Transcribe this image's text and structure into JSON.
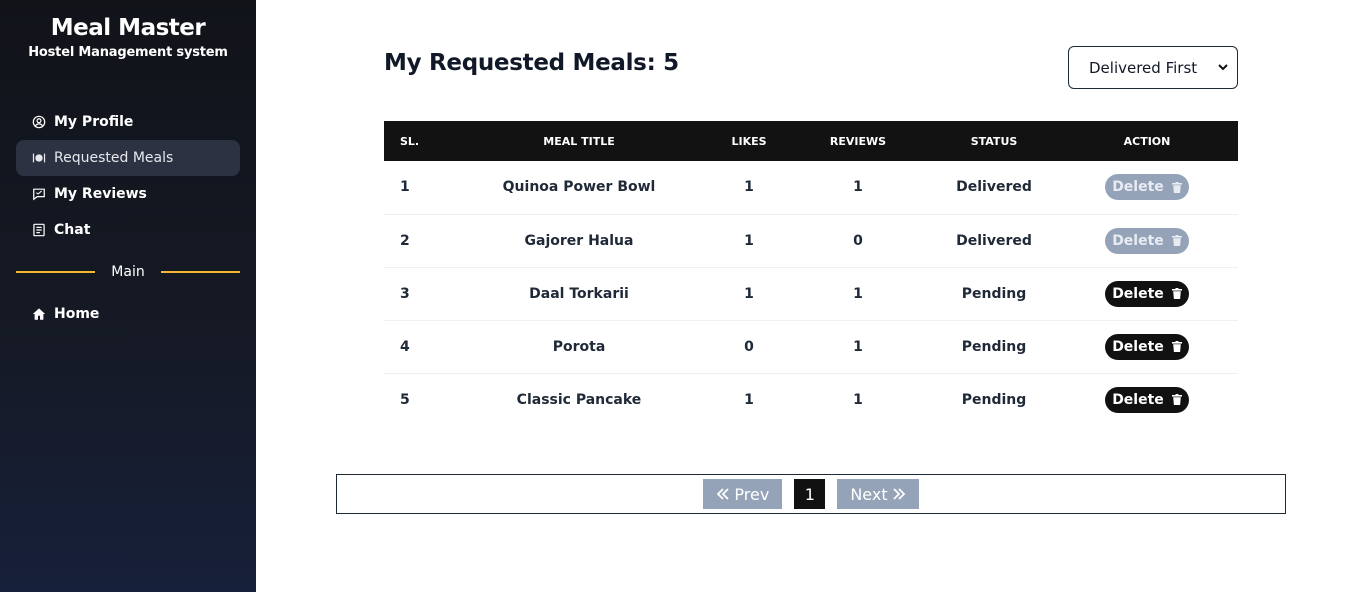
{
  "sidebar": {
    "brand_title": "Meal Master",
    "brand_subtitle": "Hostel Management system",
    "items": [
      {
        "label": "My Profile",
        "icon": "user-circle-icon"
      },
      {
        "label": "Requested Meals",
        "icon": "utensils-icon",
        "active": true
      },
      {
        "label": "My Reviews",
        "icon": "review-icon"
      },
      {
        "label": "Chat",
        "icon": "chat-icon"
      }
    ],
    "divider_label": "Main",
    "main_items": [
      {
        "label": "Home",
        "icon": "home-icon"
      }
    ],
    "accent_color": "#f5b731"
  },
  "main": {
    "heading": "My Requested Meals: 5",
    "sort": {
      "selected": "Delivered First"
    },
    "table": {
      "headers": [
        "SL.",
        "MEAL TITLE",
        "LIKES",
        "REVIEWS",
        "STATUS",
        "ACTION"
      ],
      "rows": [
        {
          "sl": "1",
          "title": "Quinoa Power Bowl",
          "likes": "1",
          "reviews": "1",
          "status": "Delivered",
          "action": "Delete"
        },
        {
          "sl": "2",
          "title": "Gajorer Halua",
          "likes": "1",
          "reviews": "0",
          "status": "Delivered",
          "action": "Delete"
        },
        {
          "sl": "3",
          "title": "Daal Torkarii",
          "likes": "1",
          "reviews": "1",
          "status": "Pending",
          "action": "Delete"
        },
        {
          "sl": "4",
          "title": "Porota",
          "likes": "0",
          "reviews": "1",
          "status": "Pending",
          "action": "Delete"
        },
        {
          "sl": "5",
          "title": "Classic Pancake",
          "likes": "1",
          "reviews": "1",
          "status": "Pending",
          "action": "Delete"
        }
      ]
    },
    "pagination": {
      "prev": "Prev",
      "current": "1",
      "next": "Next"
    },
    "colors": {
      "delivered": "#16a34a",
      "pending": "#ea580c",
      "disabled": "#94a3b8"
    }
  }
}
